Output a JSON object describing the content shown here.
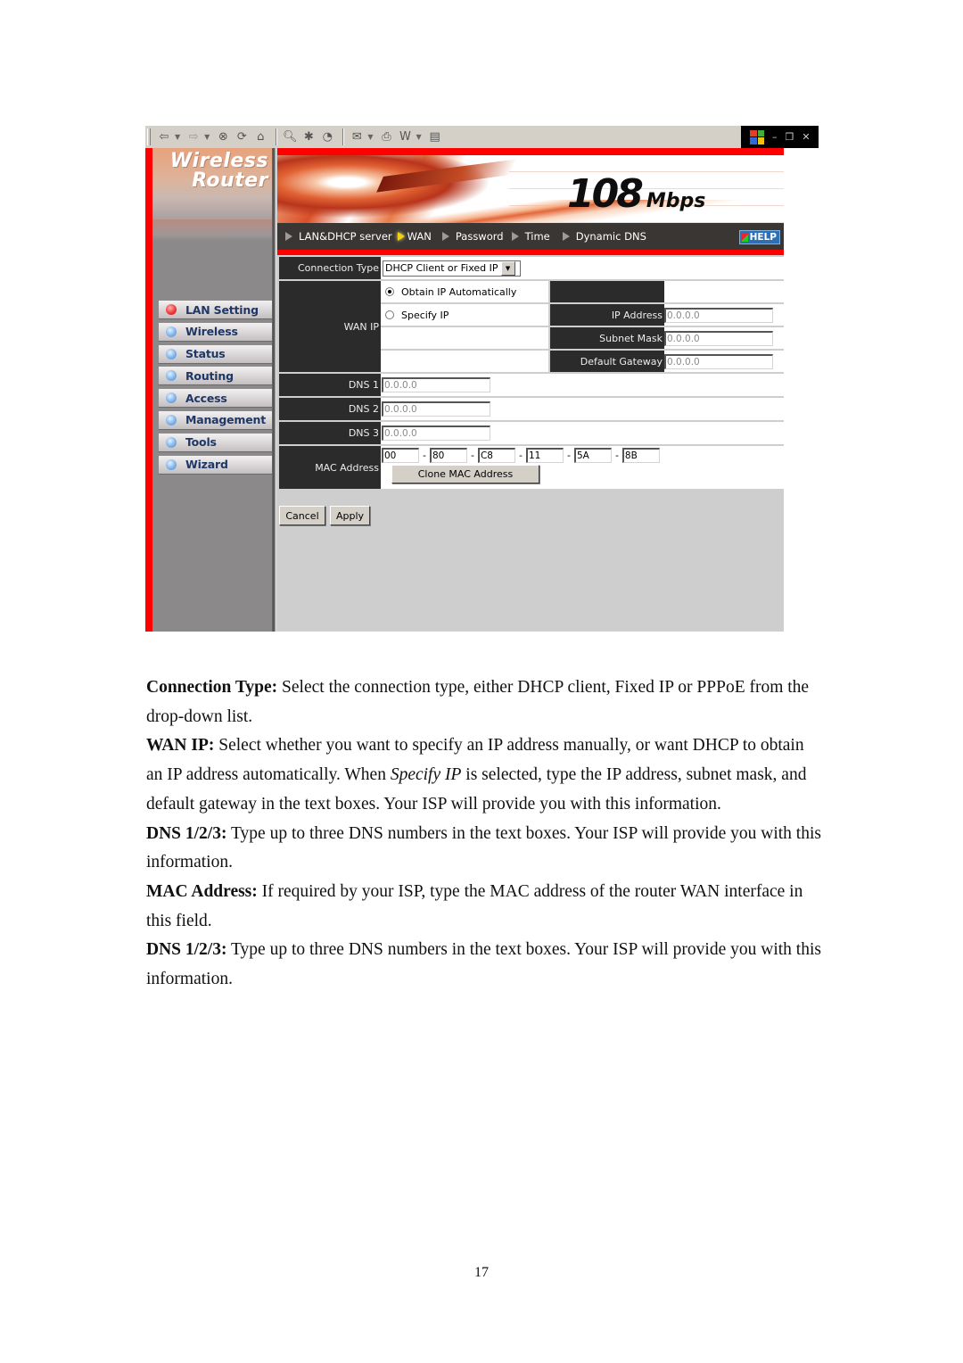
{
  "browser": {
    "toolbar_icons": [
      "back-arrow-icon",
      "forward-arrow-icon",
      "stop-icon",
      "refresh-icon",
      "home-icon",
      "search-icon",
      "favorites-icon",
      "history-icon",
      "mail-icon",
      "print-icon",
      "edit-word-icon",
      "discuss-icon"
    ],
    "window_controls": [
      "minimize",
      "restore",
      "close"
    ],
    "minimize_glyph": "–",
    "restore_glyph": "❐",
    "close_glyph": "✕"
  },
  "app": {
    "brand_line1": "Wireless",
    "brand_line2": "Router",
    "speed_number": "108",
    "speed_unit": "Mbps",
    "accent_color": "#ff0000"
  },
  "sidebar": {
    "items": [
      {
        "label": "LAN Setting",
        "active": true
      },
      {
        "label": "Wireless",
        "active": false
      },
      {
        "label": "Status",
        "active": false
      },
      {
        "label": "Routing",
        "active": false
      },
      {
        "label": "Access",
        "active": false
      },
      {
        "label": "Management",
        "active": false
      },
      {
        "label": "Tools",
        "active": false
      },
      {
        "label": "Wizard",
        "active": false
      }
    ]
  },
  "topnav": {
    "items": [
      {
        "label": "LAN&DHCP server",
        "active": false
      },
      {
        "label": "WAN",
        "active": true
      },
      {
        "label": "Password",
        "active": false
      },
      {
        "label": "Time",
        "active": false
      },
      {
        "label": "Dynamic DNS",
        "active": false
      }
    ],
    "help_label": "HELP"
  },
  "form": {
    "connection_type_label": "Connection Type",
    "connection_type_value": "DHCP Client or Fixed IP",
    "wan_ip_label": "WAN IP",
    "radio_obtain_label": "Obtain IP Automatically",
    "radio_specify_label": "Specify IP",
    "selected_radio": "obtain",
    "ip_address_label": "IP Address",
    "ip_address_value": "0.0.0.0",
    "subnet_mask_label": "Subnet Mask",
    "subnet_mask_value": "0.0.0.0",
    "default_gateway_label": "Default Gateway",
    "default_gateway_value": "0.0.0.0",
    "dns1_label": "DNS 1",
    "dns1_value": "0.0.0.0",
    "dns2_label": "DNS 2",
    "dns2_value": "0.0.0.0",
    "dns3_label": "DNS 3",
    "dns3_value": "0.0.0.0",
    "mac_label": "MAC Address",
    "mac_octets": [
      "00",
      "80",
      "C8",
      "11",
      "5A",
      "8B"
    ],
    "mac_separator": "-",
    "clone_mac_button": "Clone MAC Address",
    "cancel_button": "Cancel",
    "apply_button": "Apply"
  },
  "document": {
    "paragraphs": [
      {
        "term": "Connection Type:",
        "text": " Select the connection type, either DHCP client, Fixed IP or PPPoE from the drop-down list."
      },
      {
        "term": "WAN IP:",
        "text_before": " Select whether you want to specify an IP address manually, or want DHCP to obtain an IP address automatically. When ",
        "emphasis": "Specify IP",
        "text_after": " is selected, type the IP address, subnet mask, and default gateway in the text boxes. Your ISP will provide you with this information."
      },
      {
        "term": "DNS 1/2/3:",
        "text": " Type up to three DNS numbers in the text boxes. Your ISP will provide you with this information."
      },
      {
        "term": "MAC Address:",
        "text": " If required by your ISP, type the MAC address of the router WAN interface in this field."
      },
      {
        "term": "DNS 1/2/3:",
        "text": " Type up to three DNS numbers in the text boxes. Your ISP will provide you with this information."
      }
    ],
    "page_number": "17"
  }
}
